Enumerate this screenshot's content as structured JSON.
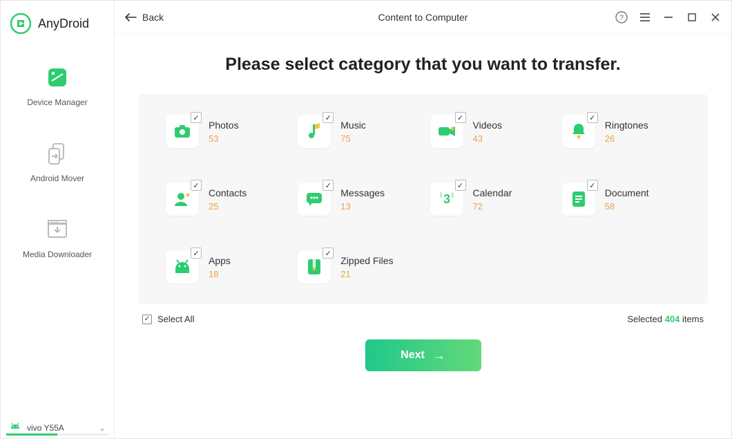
{
  "app": {
    "name": "AnyDroid"
  },
  "sidebar": {
    "items": [
      {
        "label": "Device Manager"
      },
      {
        "label": "Android Mover"
      },
      {
        "label": "Media Downloader"
      }
    ],
    "device": {
      "name": "vivo Y55A"
    }
  },
  "topbar": {
    "back": "Back",
    "title": "Content to Computer"
  },
  "main": {
    "heading": "Please select category that you want to transfer.",
    "categories": [
      {
        "label": "Photos",
        "count": "53"
      },
      {
        "label": "Music",
        "count": "75"
      },
      {
        "label": "Videos",
        "count": "43"
      },
      {
        "label": "Ringtones",
        "count": "26"
      },
      {
        "label": "Contacts",
        "count": "25"
      },
      {
        "label": "Messages",
        "count": "13"
      },
      {
        "label": "Calendar",
        "count": "72"
      },
      {
        "label": "Document",
        "count": "58"
      },
      {
        "label": "Apps",
        "count": "18"
      },
      {
        "label": "Zipped Files",
        "count": "21"
      }
    ],
    "select_all": "Select All",
    "selected_prefix": "Selected",
    "selected_count": "404",
    "selected_suffix": "items",
    "next": "Next"
  }
}
